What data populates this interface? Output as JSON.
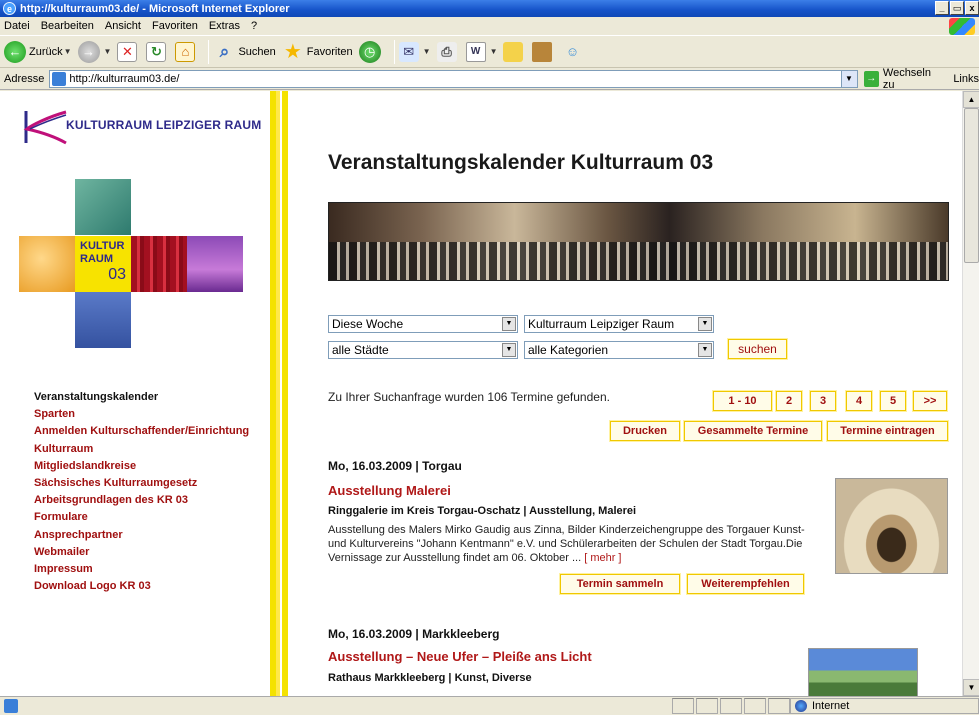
{
  "window": {
    "title": "http://kulturraum03.de/ - Microsoft Internet Explorer",
    "controls": [
      "_",
      " ",
      "x"
    ]
  },
  "menu": [
    "Datei",
    "Bearbeiten",
    "Ansicht",
    "Favoriten",
    "Extras",
    "?"
  ],
  "toolbar": {
    "back_label": "Zurück",
    "search_label": "Suchen",
    "favorites_label": "Favoriten"
  },
  "address": {
    "label": "Adresse",
    "url": "http://kulturraum03.de/",
    "go_label": "Wechseln zu",
    "links_label": "Links"
  },
  "sidebar": {
    "logo_text": "KULTURRAUM LEIPZIGER RAUM",
    "tile_text": [
      "KULTUR",
      "RAUM",
      "03"
    ],
    "nav": [
      "Veranstaltungskalender",
      "Sparten",
      "Anmelden Kulturschaffender/Einrichtung",
      "Kulturraum",
      "Mitgliedslandkreise",
      "Sächsisches Kulturraumgesetz",
      "Arbeitsgrundlagen des KR 03",
      "Formulare",
      "Ansprechpartner",
      "Webmailer",
      "Impressum",
      "Download Logo KR 03"
    ]
  },
  "main": {
    "title": "Veranstaltungskalender Kulturraum 03",
    "filters": {
      "period": "Diese Woche",
      "region": "Kulturraum Leipziger Raum",
      "city": "alle Städte",
      "category": "alle Kategorien",
      "search_button": "suchen"
    },
    "result_text": "Zu Ihrer Suchanfrage wurden 106 Termine gefunden.",
    "pagination": [
      "1 - 10",
      "2",
      "3",
      "4",
      "5",
      ">>"
    ],
    "actions": [
      "Drucken",
      "Gesammelte Termine",
      "Termine eintragen"
    ],
    "events": [
      {
        "date": "Mo, 16.03.2009 | Torgau",
        "title": "Ausstellung Malerei",
        "sub": "Ringgalerie im Kreis Torgau-Oschatz | Ausstellung, Malerei",
        "desc": "Ausstellung des Malers Mirko Gaudig aus Zinna, Bilder Kinderzeichengruppe des Torgauer Kunst- und Kulturvereins \"Johann Kentmann\" e.V. und Schülerarbeiten der Schulen der Stadt Torgau.Die Vernissage zur Ausstellung findet am 06. Oktober ...",
        "more": "[ mehr ]",
        "collect": "Termin sammeln",
        "recommend": "Weiterempfehlen"
      },
      {
        "date": "Mo, 16.03.2009 | Markkleeberg",
        "title": "Ausstellung – Neue Ufer – Pleiße ans Licht",
        "sub": "Rathaus Markkleeberg | Kunst, Diverse"
      }
    ]
  },
  "status": {
    "zone": "Internet"
  }
}
